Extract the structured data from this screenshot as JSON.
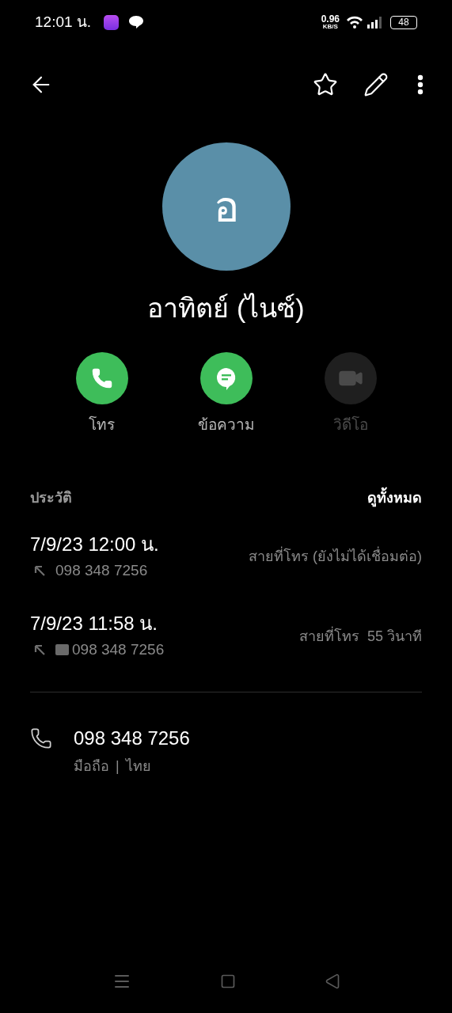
{
  "status_bar": {
    "time": "12:01 น.",
    "speed": "0.96",
    "speed_unit": "KB/S",
    "battery": "48"
  },
  "contact": {
    "initial": "อ",
    "name": "อาทิตย์ (ไนซ์)"
  },
  "actions": [
    {
      "kind": "call",
      "label": "โทร",
      "disabled": false
    },
    {
      "kind": "message",
      "label": "ข้อความ",
      "disabled": false
    },
    {
      "kind": "video",
      "label": "วิดีโอ",
      "disabled": true
    }
  ],
  "history": {
    "title": "ประวัติ",
    "see_all": "ดูทั้งหมด",
    "calls": [
      {
        "datetime": "7/9/23 12:00 น.",
        "number": "098 348 7256",
        "hd": false,
        "status": "สายที่โทร (ยังไม่ได้เชื่อมต่อ)"
      },
      {
        "datetime": "7/9/23 11:58 น.",
        "number": "098 348 7256",
        "hd": true,
        "status": "สายที่โทร  55 วินาที"
      }
    ]
  },
  "phone": {
    "number": "098 348 7256",
    "type": "มือถือ",
    "separator": "|",
    "region": "ไทย"
  }
}
